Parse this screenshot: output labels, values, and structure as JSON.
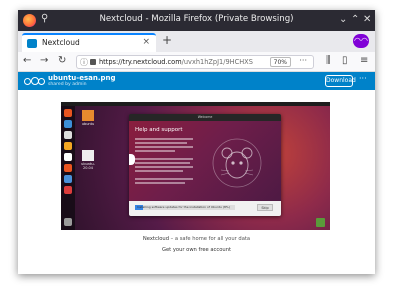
{
  "window": {
    "title": "Nextcloud - Mozilla Firefox (Private Browsing)",
    "pin_glyph": "⚲",
    "controls": {
      "minimize": "⌄",
      "maximize": "⌃",
      "close": "✕"
    }
  },
  "tabs": [
    {
      "label": "Nextcloud",
      "close": "×"
    }
  ],
  "new_tab": "+",
  "private_icon": "private-browsing-mask-icon",
  "nav": {
    "back": "←",
    "forward": "→",
    "reload": "↻",
    "info_glyph": "ⓘ",
    "url_domain": "https://try.nextcloud.com",
    "url_path": "/uvxh1hZpJ1/9HCHXS",
    "zoom": "70%",
    "page_actions": "···",
    "library": "⫼",
    "sidebar": "▯",
    "menu": "≡"
  },
  "nextcloud": {
    "file_name": "ubuntu-esan.png",
    "shared_by": "shared by admin",
    "download_label": "Download",
    "more": "···",
    "brand_color": "#0082c9"
  },
  "preview": {
    "desktop_icons": [
      {
        "label": "ubuntu"
      },
      {
        "label": "ubuntu-20.04"
      }
    ],
    "dialog": {
      "window_title": "Welcome",
      "heading": "Help and support",
      "progress_text": "Installing software updates for the installation of Ubuntu (8%)",
      "progress_fraction": 0.08,
      "skip_label": "Skip"
    }
  },
  "footer": {
    "brand": "Nextcloud",
    "tagline": " – a safe home for all your data",
    "cta": "Get your own free account"
  }
}
